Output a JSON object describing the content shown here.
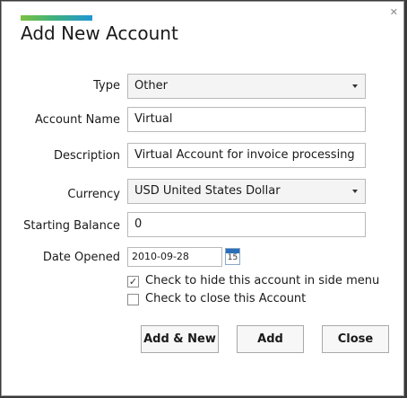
{
  "dialog": {
    "title": "Add New Account",
    "close_glyph": "✕"
  },
  "form": {
    "type": {
      "label": "Type",
      "value": "Other"
    },
    "account_name": {
      "label": "Account Name",
      "value": "Virtual"
    },
    "description": {
      "label": "Description",
      "value": "Virtual Account for invoice processing"
    },
    "currency": {
      "label": "Currency",
      "value": "USD  United States Dollar"
    },
    "starting_balance": {
      "label": "Starting Balance",
      "value": "0"
    },
    "date_opened": {
      "label": "Date Opened",
      "value": "2010-09-28",
      "calendar_day": "15"
    },
    "hide_in_menu": {
      "label": "Check to hide this account in side menu",
      "checked": true,
      "glyph": "✓"
    },
    "close_account": {
      "label": "Check to close this Account",
      "checked": false,
      "glyph": ""
    }
  },
  "buttons": {
    "add_new": "Add & New",
    "add": "Add",
    "close": "Close"
  },
  "colors": {
    "accent_start": "#7cc242",
    "accent_end": "#2196d6"
  }
}
